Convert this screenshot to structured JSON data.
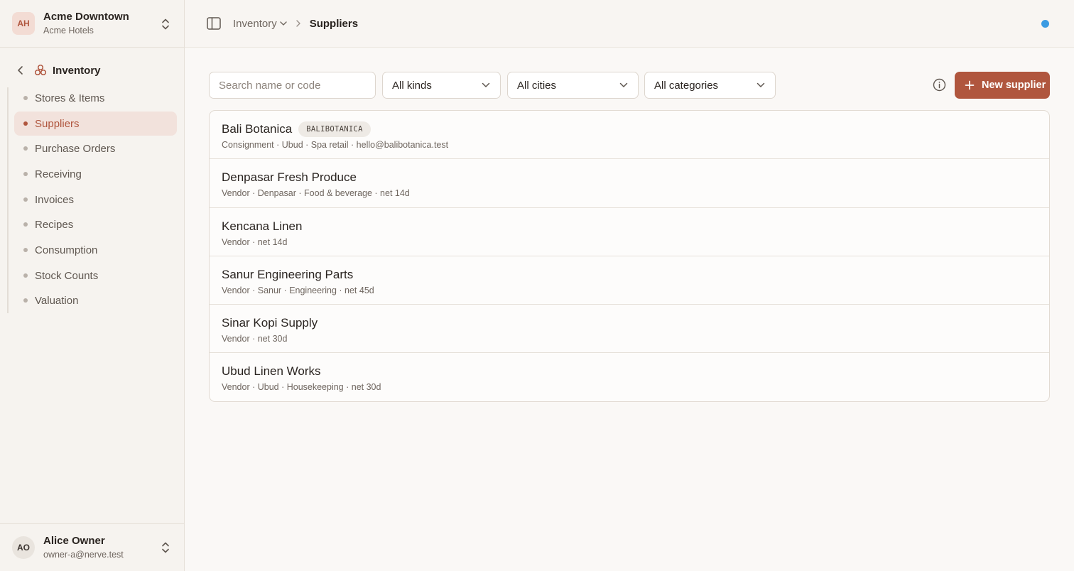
{
  "org": {
    "initials": "AH",
    "name": "Acme Downtown",
    "company": "Acme Hotels"
  },
  "sidebar": {
    "section_title": "Inventory",
    "items": [
      {
        "label": "Stores & Items",
        "active": false
      },
      {
        "label": "Suppliers",
        "active": true
      },
      {
        "label": "Purchase Orders",
        "active": false
      },
      {
        "label": "Receiving",
        "active": false
      },
      {
        "label": "Invoices",
        "active": false
      },
      {
        "label": "Recipes",
        "active": false
      },
      {
        "label": "Consumption",
        "active": false
      },
      {
        "label": "Stock Counts",
        "active": false
      },
      {
        "label": "Valuation",
        "active": false
      }
    ]
  },
  "user": {
    "initials": "AO",
    "name": "Alice Owner",
    "email": "owner-a@nerve.test"
  },
  "breadcrumb": {
    "parent": "Inventory",
    "current": "Suppliers"
  },
  "toolbar": {
    "search_placeholder": "Search name or code",
    "kind_filter": "All kinds",
    "city_filter": "All cities",
    "category_filter": "All categories",
    "new_button": "New supplier"
  },
  "suppliers": [
    {
      "name": "Bali Botanica",
      "code": "BALIBOTANICA",
      "details": "Consignment · Ubud · Spa retail · hello@balibotanica.test"
    },
    {
      "name": "Denpasar Fresh Produce",
      "code": "",
      "details": "Vendor · Denpasar · Food & beverage · net 14d"
    },
    {
      "name": "Kencana Linen",
      "code": "",
      "details": "Vendor · net 14d"
    },
    {
      "name": "Sanur Engineering Parts",
      "code": "",
      "details": "Vendor · Sanur · Engineering · net 45d"
    },
    {
      "name": "Sinar Kopi Supply",
      "code": "",
      "details": "Vendor · net 30d"
    },
    {
      "name": "Ubud Linen Works",
      "code": "",
      "details": "Vendor · Ubud · Housekeeping · net 30d"
    }
  ],
  "colors": {
    "accent": "#b0563e",
    "status_dot": "#3b9be2",
    "active_bg": "#f2e2dc"
  },
  "icons": [
    "chevron-up-down-icon",
    "chevron-left-icon",
    "inventory-icon",
    "sidebar-toggle-icon",
    "chevron-down-icon",
    "chevron-right-icon",
    "info-icon",
    "plus-icon"
  ]
}
